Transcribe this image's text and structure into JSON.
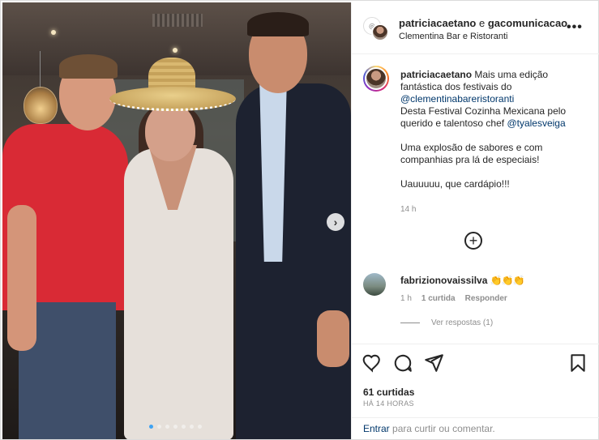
{
  "header": {
    "author_primary": "patriciacaetano",
    "author_joiner": "e",
    "author_secondary": "gacomunicacao",
    "location": "Clementina Bar e Ristoranti",
    "more_label": "•••"
  },
  "photo": {
    "next_label": "›",
    "dots_total": 7,
    "dots_active": 1
  },
  "caption": {
    "username": "patriciacaetano",
    "text1": "Mais uma edição fantástica dos festivais do",
    "mention1": "@clementinabareristoranti",
    "text2": "Desta Festival Cozinha Mexicana pelo querido e talentoso chef",
    "mention2": "@tyalesveiga",
    "text3": "Uma explosão de sabores e com companhias pra lá de especiais!",
    "text4": "Uauuuuu, que cardápio!!!",
    "time": "14 h"
  },
  "comment": {
    "username": "fabrizionovaissilva",
    "emoji": "👏👏👏",
    "time": "1 h",
    "likes": "1 curtida",
    "reply": "Responder",
    "view_replies": "Ver respostas (1)"
  },
  "actions": {
    "likes": "61 curtidas",
    "posted": "HÁ 14 HORAS"
  },
  "footer": {
    "login": "Entrar",
    "rest": "para curtir ou comentar."
  },
  "icons": {
    "more": "more-icon",
    "next": "chevron-right-icon",
    "add": "add-circle-icon",
    "like": "heart-icon",
    "comment": "comment-icon",
    "share": "share-icon",
    "save": "bookmark-icon"
  }
}
